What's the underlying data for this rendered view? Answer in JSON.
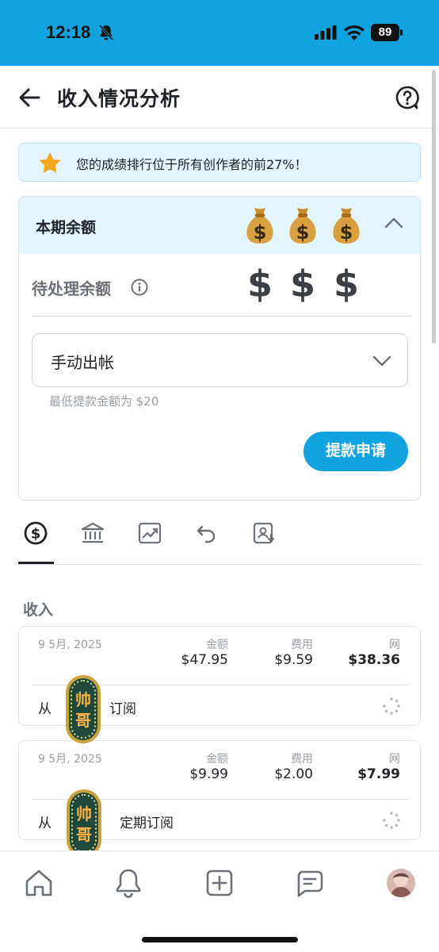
{
  "status_bar": {
    "time": "12:18",
    "battery": "89"
  },
  "header": {
    "title": "收入情况分析"
  },
  "banner": {
    "text": "您的成绩排行位于所有创作者的前27%！"
  },
  "balance": {
    "title": "本期余额",
    "pending_label": "待处理余额",
    "dollar_glyph": "$",
    "payout_mode": "手动出帐",
    "min_note": "最低提款金额为 $20",
    "withdraw_button": "提款申请"
  },
  "tabs": [
    {
      "icon": "dollar-circle-icon",
      "active": true
    },
    {
      "icon": "bank-icon",
      "active": false
    },
    {
      "icon": "chart-trend-icon",
      "active": false
    },
    {
      "icon": "refund-icon",
      "active": false
    },
    {
      "icon": "statement-icon",
      "active": false
    }
  ],
  "income": {
    "section_label": "收入",
    "columns": {
      "amount": "金额",
      "fee": "费用",
      "net": "网"
    },
    "transactions": [
      {
        "date": "9 5月, 2025",
        "amount": "$47.95",
        "fee": "$9.59",
        "net": "$38.36",
        "from": "从",
        "type": "订阅"
      },
      {
        "date": "9 5月, 2025",
        "amount": "$9.99",
        "fee": "$2.00",
        "net": "$7.99",
        "from": "从",
        "type": "定期订阅"
      }
    ]
  },
  "sticker_text": "帅哥",
  "nav": [
    "home-icon",
    "bell-icon",
    "add-post-icon",
    "messages-icon",
    "avatar"
  ],
  "colors": {
    "accent": "#10a3e0",
    "banner_bg": "#e3f4fc"
  }
}
